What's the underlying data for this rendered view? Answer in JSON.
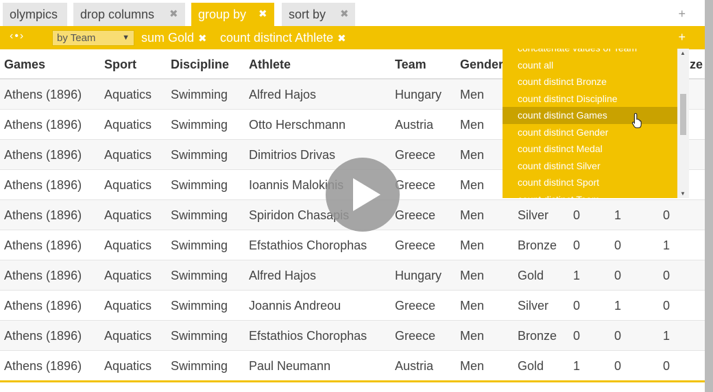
{
  "tabs": [
    {
      "label": "olympics",
      "closable": false,
      "active": false
    },
    {
      "label": "drop columns",
      "closable": true,
      "active": false
    },
    {
      "label": "group by",
      "closable": true,
      "active": true
    },
    {
      "label": "sort by",
      "closable": true,
      "active": false
    }
  ],
  "tab_close_glyph": "✖",
  "add_glyph": "+",
  "opbar": {
    "nav": "‹•›",
    "select_value": "by Team",
    "select_caret": "▼",
    "chips": [
      "sum Gold",
      "count distinct Athlete"
    ]
  },
  "columns": [
    "Games",
    "Sport",
    "Discipline",
    "Athlete",
    "Team",
    "Gender",
    "ze"
  ],
  "rows": [
    [
      "Athens (1896)",
      "Aquatics",
      "Swimming",
      "Alfred Hajos",
      "Hungary",
      "Men",
      "",
      "",
      "",
      ""
    ],
    [
      "Athens (1896)",
      "Aquatics",
      "Swimming",
      "Otto Herschmann",
      "Austria",
      "Men",
      "",
      "",
      "",
      ""
    ],
    [
      "Athens (1896)",
      "Aquatics",
      "Swimming",
      "Dimitrios Drivas",
      "Greece",
      "Men",
      "",
      "",
      "",
      ""
    ],
    [
      "Athens (1896)",
      "Aquatics",
      "Swimming",
      "Ioannis Malokinis",
      "Greece",
      "Men",
      "",
      "",
      "",
      ""
    ],
    [
      "Athens (1896)",
      "Aquatics",
      "Swimming",
      "Spiridon Chasapis",
      "Greece",
      "Men",
      "Silver",
      "0",
      "1",
      "0"
    ],
    [
      "Athens (1896)",
      "Aquatics",
      "Swimming",
      "Efstathios Chorophas",
      "Greece",
      "Men",
      "Bronze",
      "0",
      "0",
      "1"
    ],
    [
      "Athens (1896)",
      "Aquatics",
      "Swimming",
      "Alfred Hajos",
      "Hungary",
      "Men",
      "Gold",
      "1",
      "0",
      "0"
    ],
    [
      "Athens (1896)",
      "Aquatics",
      "Swimming",
      "Joannis Andreou",
      "Greece",
      "Men",
      "Silver",
      "0",
      "1",
      "0"
    ],
    [
      "Athens (1896)",
      "Aquatics",
      "Swimming",
      "Efstathios Chorophas",
      "Greece",
      "Men",
      "Bronze",
      "0",
      "0",
      "1"
    ],
    [
      "Athens (1896)",
      "Aquatics",
      "Swimming",
      "Paul Neumann",
      "Austria",
      "Men",
      "Gold",
      "1",
      "0",
      "0"
    ]
  ],
  "dropdown": {
    "items": [
      "concatenate values of Team",
      "count all",
      "count distinct Bronze",
      "count distinct Discipline",
      "count distinct Games",
      "count distinct Gender",
      "count distinct Medal",
      "count distinct Silver",
      "count distinct Sport",
      "count distinct Team"
    ],
    "highlighted": "count distinct Games",
    "scroll_up": "▲",
    "scroll_down": "▼"
  },
  "colors": {
    "accent": "#f2c200",
    "accent_dark": "#c9a200",
    "tab_inactive": "#e6e6e6"
  },
  "icons": [
    "close-icon",
    "plus-icon",
    "chevron-left-icon",
    "chevron-right-icon",
    "dropdown-caret-icon",
    "play-icon",
    "hand-cursor-icon"
  ]
}
